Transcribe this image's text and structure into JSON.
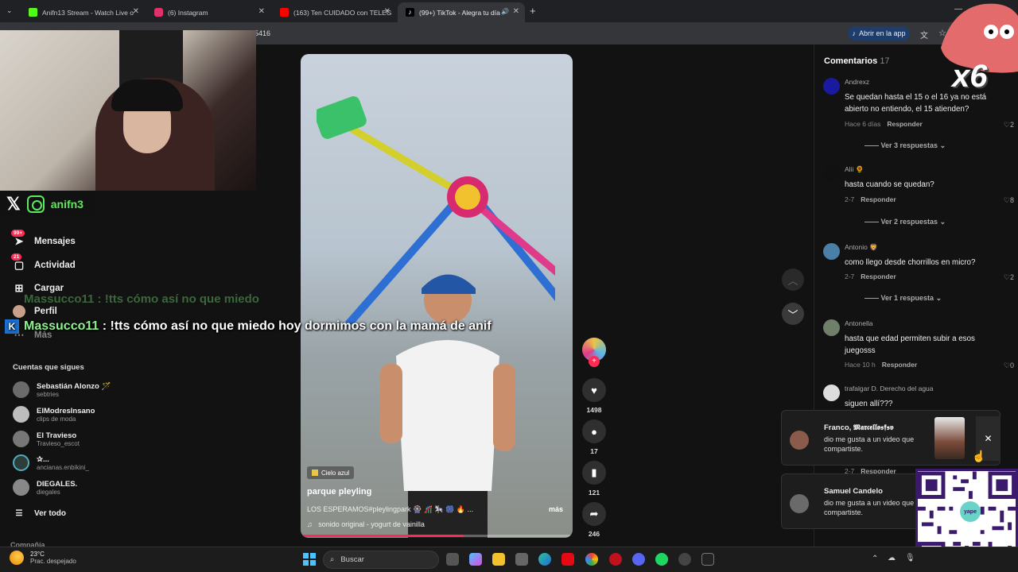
{
  "browser": {
    "tabs": [
      {
        "title": "Anifn13 Stream - Watch Live o",
        "color": "#53fc18"
      },
      {
        "title": "(6) Instagram",
        "color": "#e1306c"
      },
      {
        "title": "(163) Ten CUIDADO con TELEG",
        "color": "#ff0000"
      },
      {
        "title": "(99+) TikTok - Alegra tu día",
        "color": "#ffffff"
      }
    ],
    "url_fragment": "5416",
    "open_in_app": "Abrir en la app"
  },
  "overlay": {
    "socials_handle": "anifn3",
    "chat_faded": "Massucco11 : !tts cómo así no que miedo",
    "chat_user": "Massucco11",
    "chat_message": " : !tts cómo así no que miedo hoy dormimos con la mamá de anif",
    "sticker_text": "x6"
  },
  "sidebar": {
    "items": [
      {
        "label": "Mensajes",
        "badge": "99+",
        "icon": "paper-plane-icon"
      },
      {
        "label": "Actividad",
        "badge": "21",
        "icon": "chat-bubble-icon"
      },
      {
        "label": "Cargar",
        "icon": "plus-square-icon"
      },
      {
        "label": "Perfil",
        "icon": "user-icon"
      },
      {
        "label": "Más",
        "icon": "more-icon"
      }
    ],
    "following_title": "Cuentas que sigues",
    "following": [
      {
        "name": "Sebastián Alonzo 🪄",
        "handle": "sebtries"
      },
      {
        "name": "ElModresInsano",
        "handle": "clips de moda"
      },
      {
        "name": "El Travieso",
        "handle": "Travieso_escot"
      },
      {
        "name": "✰...",
        "handle": "ancianas.enbikini_"
      },
      {
        "name": "DIEGALES.",
        "handle": "diegales"
      }
    ],
    "see_all": "Ver todo",
    "company": "Compañía"
  },
  "video": {
    "tag": "Cielo azul",
    "title": "parque pleyling",
    "description": "LOS ESPERAMOS#pleylingpark 🎡 🎢 🎠 🎆 🔥 ...",
    "more": "más",
    "music": "sonido original - yogurt de vainilla",
    "progress": 0.6,
    "likes": "1498",
    "comments": "17",
    "saves": "121",
    "shares": "246"
  },
  "comments_panel": {
    "title": "Comentarios",
    "count": "17",
    "comments": [
      {
        "user": "Andrexz",
        "text": "Se quedan hasta el 15 o el 16 ya no está abierto no entiendo, el 15 atienden?",
        "time": "Hace 6 días",
        "reply": "Responder",
        "likes": "2",
        "replies": "Ver 3 respuestas"
      },
      {
        "user": "Alii 🌻",
        "text": "hasta cuando se quedan?",
        "time": "2-7",
        "reply": "Responder",
        "likes": "8",
        "replies": "Ver 2 respuestas"
      },
      {
        "user": "Antonio 🦁",
        "text": "como llego desde chorrillos en micro?",
        "time": "2-7",
        "reply": "Responder",
        "likes": "2",
        "replies": "Ver 1 respuesta"
      },
      {
        "user": "Antonella",
        "text": "hasta que edad permiten subir a esos juegosss",
        "time": "Hace 10 h",
        "reply": "Responder",
        "likes": "0"
      },
      {
        "user": "trafalgar D. Derecho del agua",
        "text": "siguen allí???",
        "time": "2-7",
        "reply": "Responder"
      }
    ]
  },
  "notifications": [
    {
      "name": "Franco, 𝕸𝖆𝖗𝖈𝖊𝖑𝖑𝖔𝖘𝖋𝖘𝖛",
      "message": "dio me gusta a un video que compartiste."
    },
    {
      "name": "Samuel Candelo",
      "message": "dio me gusta a un video que compartiste."
    }
  ],
  "qr": {
    "brand": "yape"
  },
  "taskbar": {
    "temperature": "23°C",
    "weather": "Prac. despejado",
    "search": "Buscar"
  },
  "colors": {
    "accent": "#fe2c55",
    "green": "#5eea5e",
    "bg": "#121212"
  }
}
